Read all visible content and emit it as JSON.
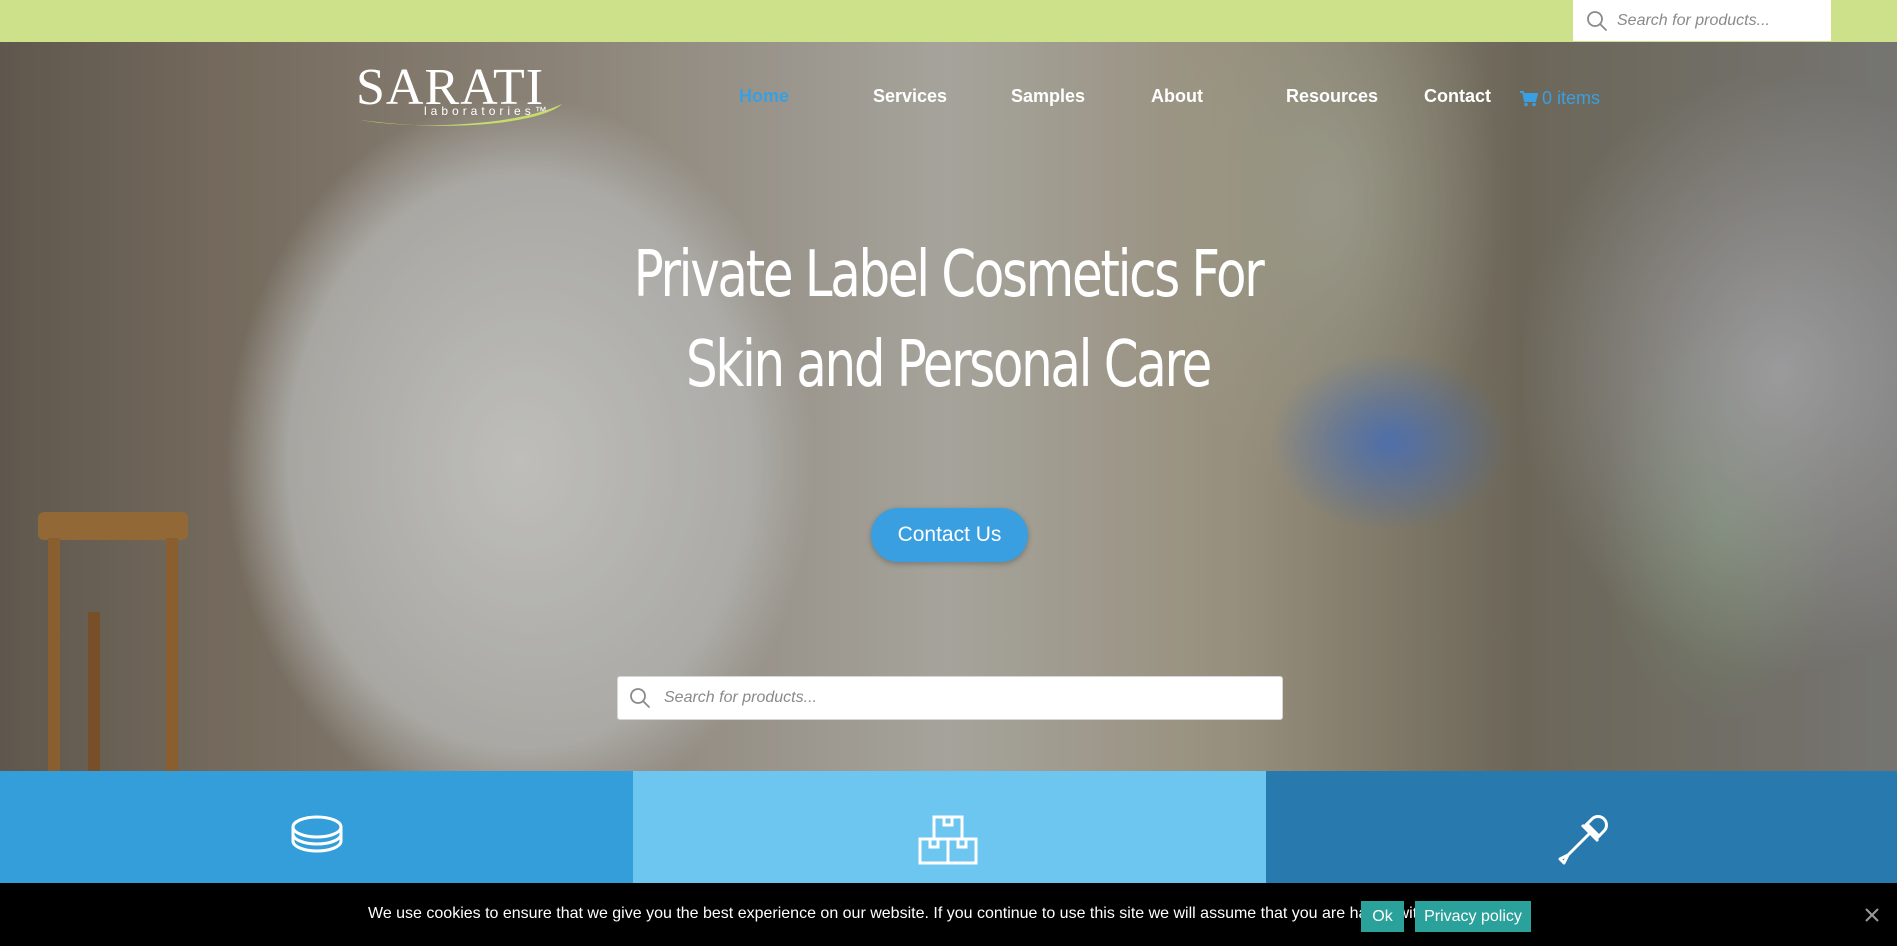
{
  "top_search": {
    "placeholder": "Search for products..."
  },
  "logo": {
    "brand": "SARATI",
    "subtitle": "laboratories™"
  },
  "nav": {
    "items": [
      {
        "label": "Home",
        "active": true
      },
      {
        "label": "Services",
        "active": false
      },
      {
        "label": "Samples",
        "active": false
      },
      {
        "label": "About",
        "active": false
      },
      {
        "label": "Resources",
        "active": false
      },
      {
        "label": "Contact",
        "active": false
      }
    ],
    "cart_label": "0 items"
  },
  "hero": {
    "headline_line1": "Private Label Cosmetics For",
    "headline_line2": "Skin and Personal Care",
    "cta_label": "Contact Us",
    "search_placeholder": "Search for products..."
  },
  "features": [
    {
      "icon": "capsule-icon",
      "color": "#339ed9"
    },
    {
      "icon": "boxes-icon",
      "color": "#6cc6ef"
    },
    {
      "icon": "dropper-icon",
      "color": "#2879ad"
    }
  ],
  "cookie": {
    "message": "We use cookies to ensure that we give you the best experience on our website. If you continue to use this site we will assume that you are happy with it.",
    "ok_label": "Ok",
    "privacy_label": "Privacy policy"
  },
  "colors": {
    "accent": "#3a9fe0",
    "topbar": "#cde08a",
    "cookie_button": "#2aa19a"
  }
}
